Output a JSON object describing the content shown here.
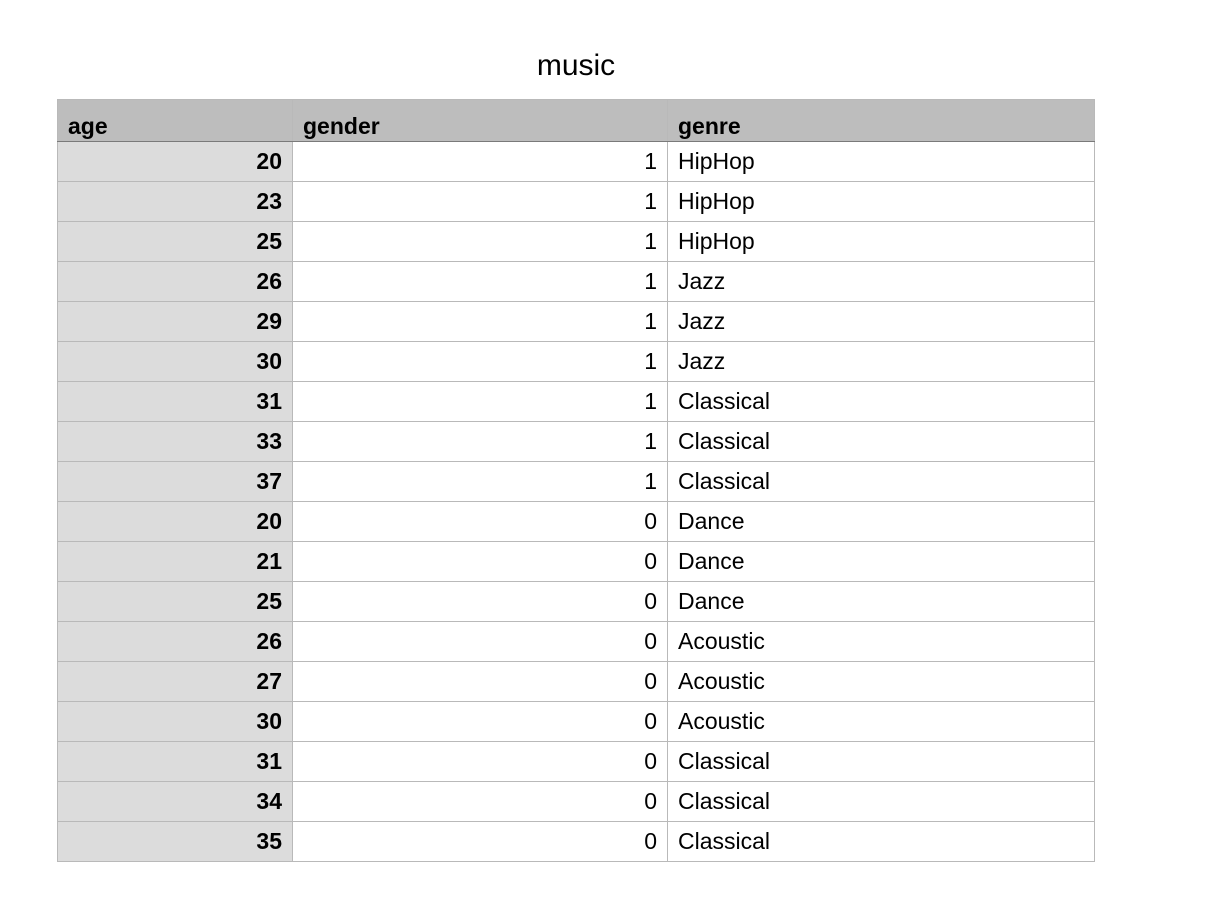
{
  "title": "music",
  "columns": [
    "age",
    "gender",
    "genre"
  ],
  "rows": [
    {
      "age": "20",
      "gender": "1",
      "genre": "HipHop"
    },
    {
      "age": "23",
      "gender": "1",
      "genre": "HipHop"
    },
    {
      "age": "25",
      "gender": "1",
      "genre": "HipHop"
    },
    {
      "age": "26",
      "gender": "1",
      "genre": "Jazz"
    },
    {
      "age": "29",
      "gender": "1",
      "genre": "Jazz"
    },
    {
      "age": "30",
      "gender": "1",
      "genre": "Jazz"
    },
    {
      "age": "31",
      "gender": "1",
      "genre": "Classical"
    },
    {
      "age": "33",
      "gender": "1",
      "genre": "Classical"
    },
    {
      "age": "37",
      "gender": "1",
      "genre": "Classical"
    },
    {
      "age": "20",
      "gender": "0",
      "genre": "Dance"
    },
    {
      "age": "21",
      "gender": "0",
      "genre": "Dance"
    },
    {
      "age": "25",
      "gender": "0",
      "genre": "Dance"
    },
    {
      "age": "26",
      "gender": "0",
      "genre": "Acoustic"
    },
    {
      "age": "27",
      "gender": "0",
      "genre": "Acoustic"
    },
    {
      "age": "30",
      "gender": "0",
      "genre": "Acoustic"
    },
    {
      "age": "31",
      "gender": "0",
      "genre": "Classical"
    },
    {
      "age": "34",
      "gender": "0",
      "genre": "Classical"
    },
    {
      "age": "35",
      "gender": "0",
      "genre": "Classical"
    }
  ],
  "colors": {
    "header_bg": "#bdbdbd",
    "age_col_bg": "#dcdcdc",
    "grid_line": "#b9b9b9"
  }
}
